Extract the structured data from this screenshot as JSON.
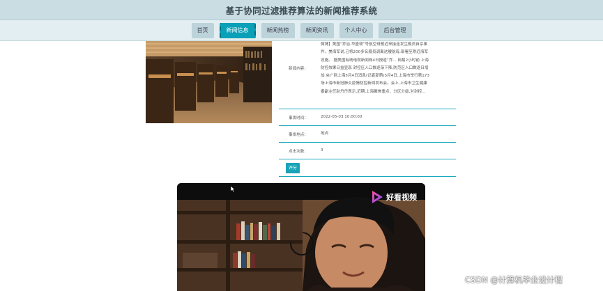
{
  "app": {
    "title": "基于协同过滤推荐算法的新闻推荐系统"
  },
  "nav": {
    "items": [
      {
        "label": "首页",
        "active": false
      },
      {
        "label": "新闻信息",
        "active": true
      },
      {
        "label": "新闻热榜",
        "active": false
      },
      {
        "label": "新闻资讯",
        "active": false
      },
      {
        "label": "个人中心",
        "active": false
      },
      {
        "label": "后台管理",
        "active": false
      }
    ]
  },
  "detail": {
    "content_label": "新闻内容：",
    "content_lines": [
      "微博】美国“乔治·华盛顿”号航空母舰近来接连发生舰员自杀事",
      "件。美海军说,已将200多名舰员调离这艘航母,部署至附近海军",
      "设施。  据美国有线电视新闻网4日报道“乔...  网易2小时前 上海",
      "防控效果日益显现 封控区人口数逐渐下降,防范区人口数逐日增",
      "加 央广网上海5月4日消息(记者郭萌)5月4日,上海市举行第173",
      "场上海市新冠肺炎疫情防控新闻发布会。会上,上海市卫生健康",
      "委副主任赵丹丹表示,近期,上海聚焦重点、分区分级,对封控..."
    ],
    "time_label": "事发时间：",
    "time_value": "2022-05-03 10:00:00",
    "place_label": "事发地点：",
    "place_value": "地点",
    "clicks_label": "点击次数：",
    "clicks_value": "3",
    "rate_button": "评分"
  },
  "video": {
    "brand": "好看视频"
  },
  "watermark": "CSDN @计算机毕业设计程"
}
